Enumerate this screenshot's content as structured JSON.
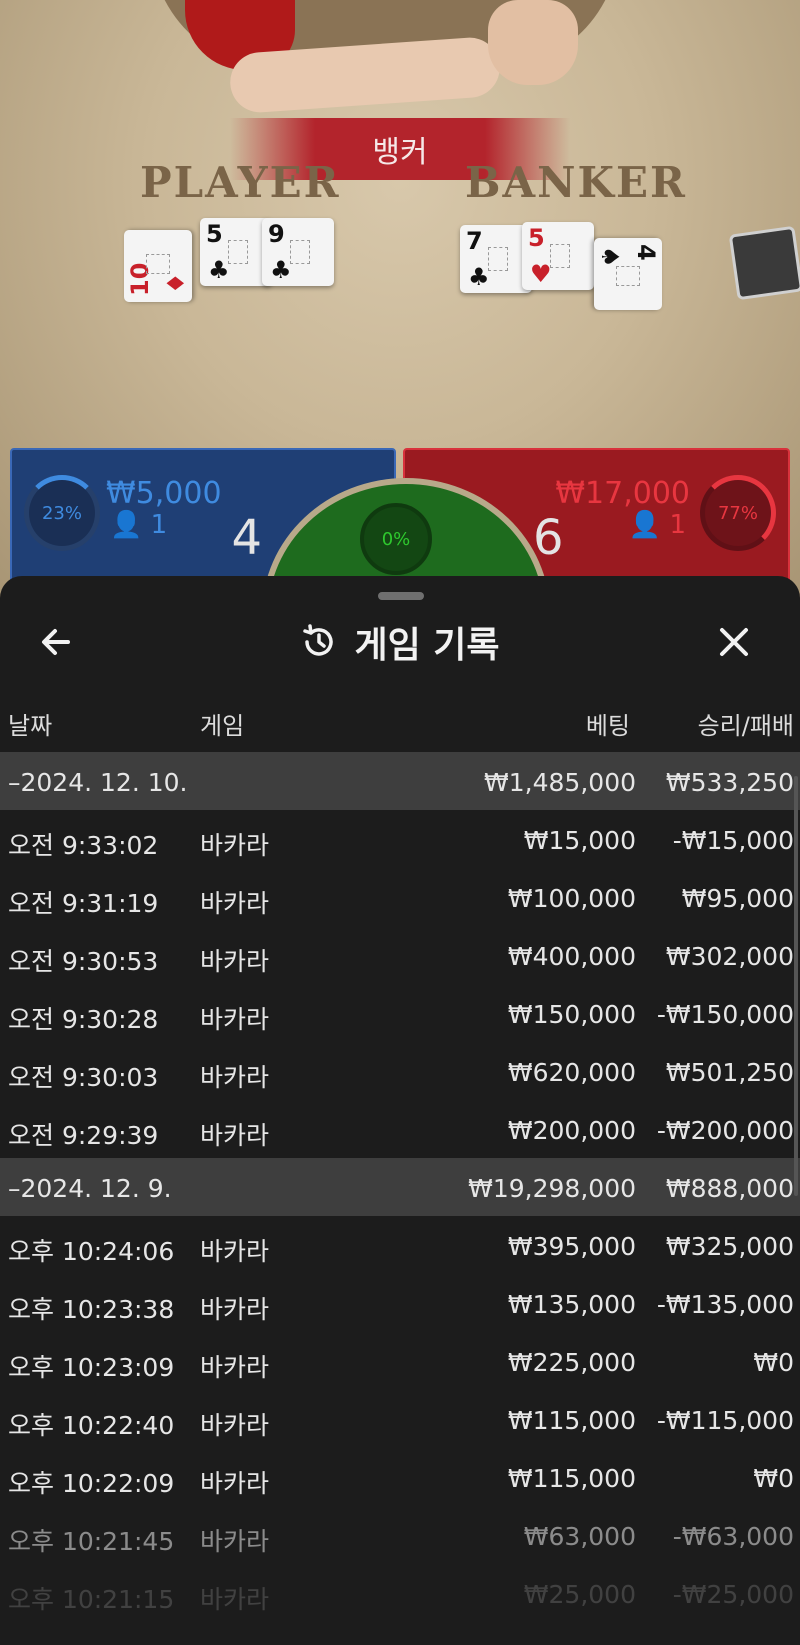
{
  "scene": {
    "result_banner": "뱅커",
    "player_label": "PLAYER",
    "banker_label": "BANKER",
    "player_cards": [
      {
        "rank": "10",
        "suit": "♦",
        "color": "red"
      },
      {
        "rank": "5",
        "suit": "♣",
        "color": "black"
      },
      {
        "rank": "9",
        "suit": "♣",
        "color": "black"
      }
    ],
    "banker_cards": [
      {
        "rank": "7",
        "suit": "♣",
        "color": "black"
      },
      {
        "rank": "5",
        "suit": "♥",
        "color": "red"
      },
      {
        "rank": "4",
        "suit": "♠",
        "color": "black"
      }
    ],
    "player_bet": {
      "percent": "23%",
      "amount": "₩5,000",
      "count": "1",
      "score": "4"
    },
    "banker_bet": {
      "percent": "77%",
      "amount": "₩17,000",
      "count": "1",
      "score": "6"
    },
    "tie_bet": {
      "percent": "0%"
    },
    "colors": {
      "player": "#3f8be0",
      "banker": "#e83640",
      "tie": "#2ec82e"
    }
  },
  "sheet": {
    "title": "게임 기록",
    "icons": {
      "back": "arrow-left-icon",
      "history": "history-icon",
      "close": "close-icon"
    },
    "columns": {
      "date": "날짜",
      "game": "게임",
      "bet": "베팅",
      "result": "승리/패배"
    },
    "rows": [
      {
        "type": "group",
        "date": "–2024. 12. 10.",
        "game": "",
        "bet": "₩1,485,000",
        "result": "₩533,250"
      },
      {
        "type": "item",
        "date": "오전 9:33:02",
        "game": "바카라",
        "bet": "₩15,000",
        "result": "-₩15,000"
      },
      {
        "type": "item",
        "date": "오전 9:31:19",
        "game": "바카라",
        "bet": "₩100,000",
        "result": "₩95,000"
      },
      {
        "type": "item",
        "date": "오전 9:30:53",
        "game": "바카라",
        "bet": "₩400,000",
        "result": "₩302,000"
      },
      {
        "type": "item",
        "date": "오전 9:30:28",
        "game": "바카라",
        "bet": "₩150,000",
        "result": "-₩150,000"
      },
      {
        "type": "item",
        "date": "오전 9:30:03",
        "game": "바카라",
        "bet": "₩620,000",
        "result": "₩501,250"
      },
      {
        "type": "item",
        "date": "오전 9:29:39",
        "game": "바카라",
        "bet": "₩200,000",
        "result": "-₩200,000"
      },
      {
        "type": "group",
        "date": "–2024. 12. 9.",
        "game": "",
        "bet": "₩19,298,000",
        "result": "₩888,000"
      },
      {
        "type": "item",
        "date": "오후 10:24:06",
        "game": "바카라",
        "bet": "₩395,000",
        "result": "₩325,000"
      },
      {
        "type": "item",
        "date": "오후 10:23:38",
        "game": "바카라",
        "bet": "₩135,000",
        "result": "-₩135,000"
      },
      {
        "type": "item",
        "date": "오후 10:23:09",
        "game": "바카라",
        "bet": "₩225,000",
        "result": "₩0"
      },
      {
        "type": "item",
        "date": "오후 10:22:40",
        "game": "바카라",
        "bet": "₩115,000",
        "result": "-₩115,000"
      },
      {
        "type": "item",
        "date": "오후 10:22:09",
        "game": "바카라",
        "bet": "₩115,000",
        "result": "₩0"
      },
      {
        "type": "item",
        "date": "오후 10:21:45",
        "game": "바카라",
        "bet": "₩63,000",
        "result": "-₩63,000"
      },
      {
        "type": "item",
        "date": "오후 10:21:15",
        "game": "바카라",
        "bet": "₩25,000",
        "result": "-₩25,000"
      }
    ]
  }
}
